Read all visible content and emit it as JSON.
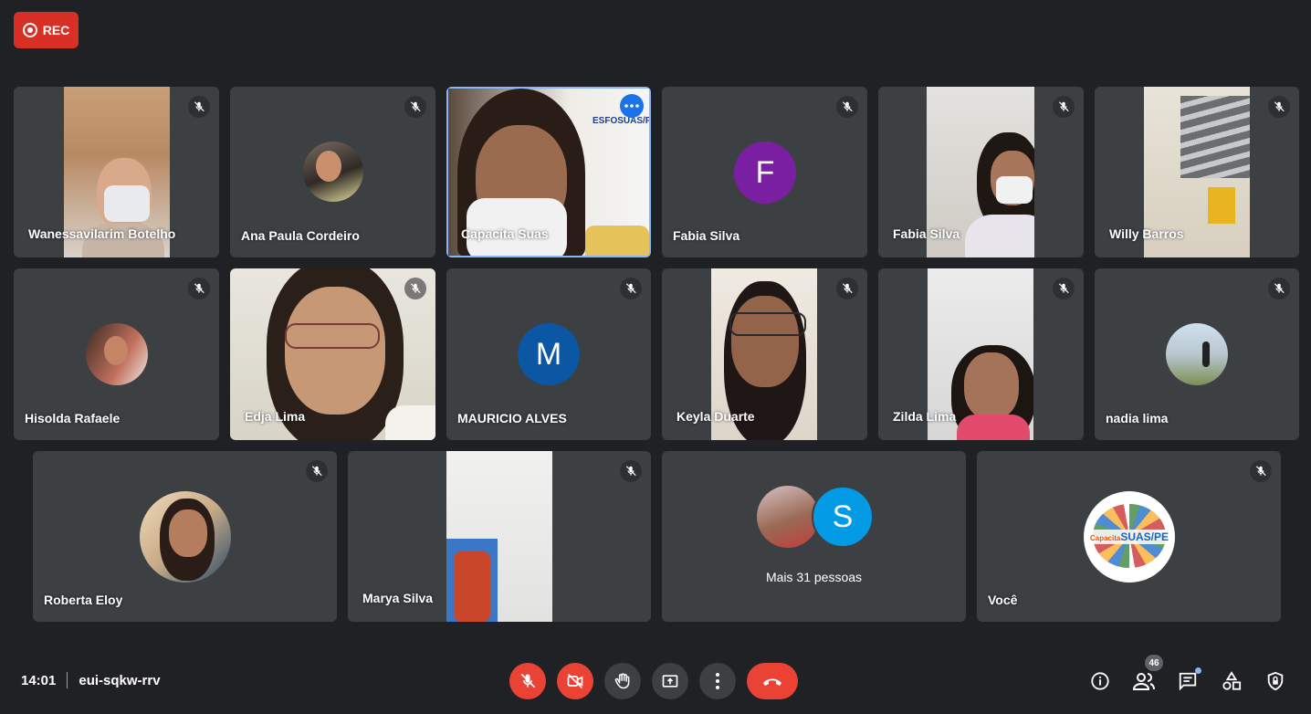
{
  "recording": {
    "label": "REC",
    "color": "#d93025"
  },
  "participants": [
    {
      "name": "Wanessavilarim Botelho",
      "type": "video"
    },
    {
      "name": "Ana Paula Cordeiro",
      "type": "photo"
    },
    {
      "name": "Capacita Suas",
      "type": "video",
      "active": true,
      "banner": "ESFOSUAS/PE"
    },
    {
      "name": "Fabia Silva",
      "type": "initial",
      "initial": "F",
      "color": "#7b1fa2"
    },
    {
      "name": "Fabia Silva",
      "type": "video"
    },
    {
      "name": "Willy Barros",
      "type": "video"
    },
    {
      "name": "Hisolda Rafaele",
      "type": "photo"
    },
    {
      "name": "Edja Lima",
      "type": "video"
    },
    {
      "name": "MAURICIO ALVES",
      "type": "initial",
      "initial": "M",
      "color": "#0b57a4"
    },
    {
      "name": "Keyla Duarte",
      "type": "video"
    },
    {
      "name": "Zilda Lima",
      "type": "video"
    },
    {
      "name": "nadia lima",
      "type": "photo"
    },
    {
      "name": "Roberta Eloy",
      "type": "photo"
    },
    {
      "name": "Marya Silva",
      "type": "video"
    },
    {
      "name": "",
      "type": "more",
      "initial": "S",
      "color": "#039be5",
      "label": "Mais 31 pessoas"
    },
    {
      "name": "Você",
      "type": "logo",
      "logo_text": "SUAS/PE",
      "logo_prefix": "Capacita"
    }
  ],
  "meeting": {
    "time": "14:01",
    "code": "eui-sqkw-rrv"
  },
  "controls": [
    {
      "name": "mic-off-button",
      "icon": "mic-off-icon"
    },
    {
      "name": "camera-off-button",
      "icon": "camera-off-icon"
    },
    {
      "name": "raise-hand-button",
      "icon": "hand-icon"
    },
    {
      "name": "present-button",
      "icon": "present-icon"
    },
    {
      "name": "more-options-button",
      "icon": "more-vert-icon"
    },
    {
      "name": "leave-call-button",
      "icon": "phone-hangup-icon"
    }
  ],
  "right_panel": {
    "participant_count": "46"
  },
  "colors": {
    "background": "#202124",
    "tile": "#3c4043",
    "danger": "#ea4335",
    "accent": "#8ab4f8"
  }
}
